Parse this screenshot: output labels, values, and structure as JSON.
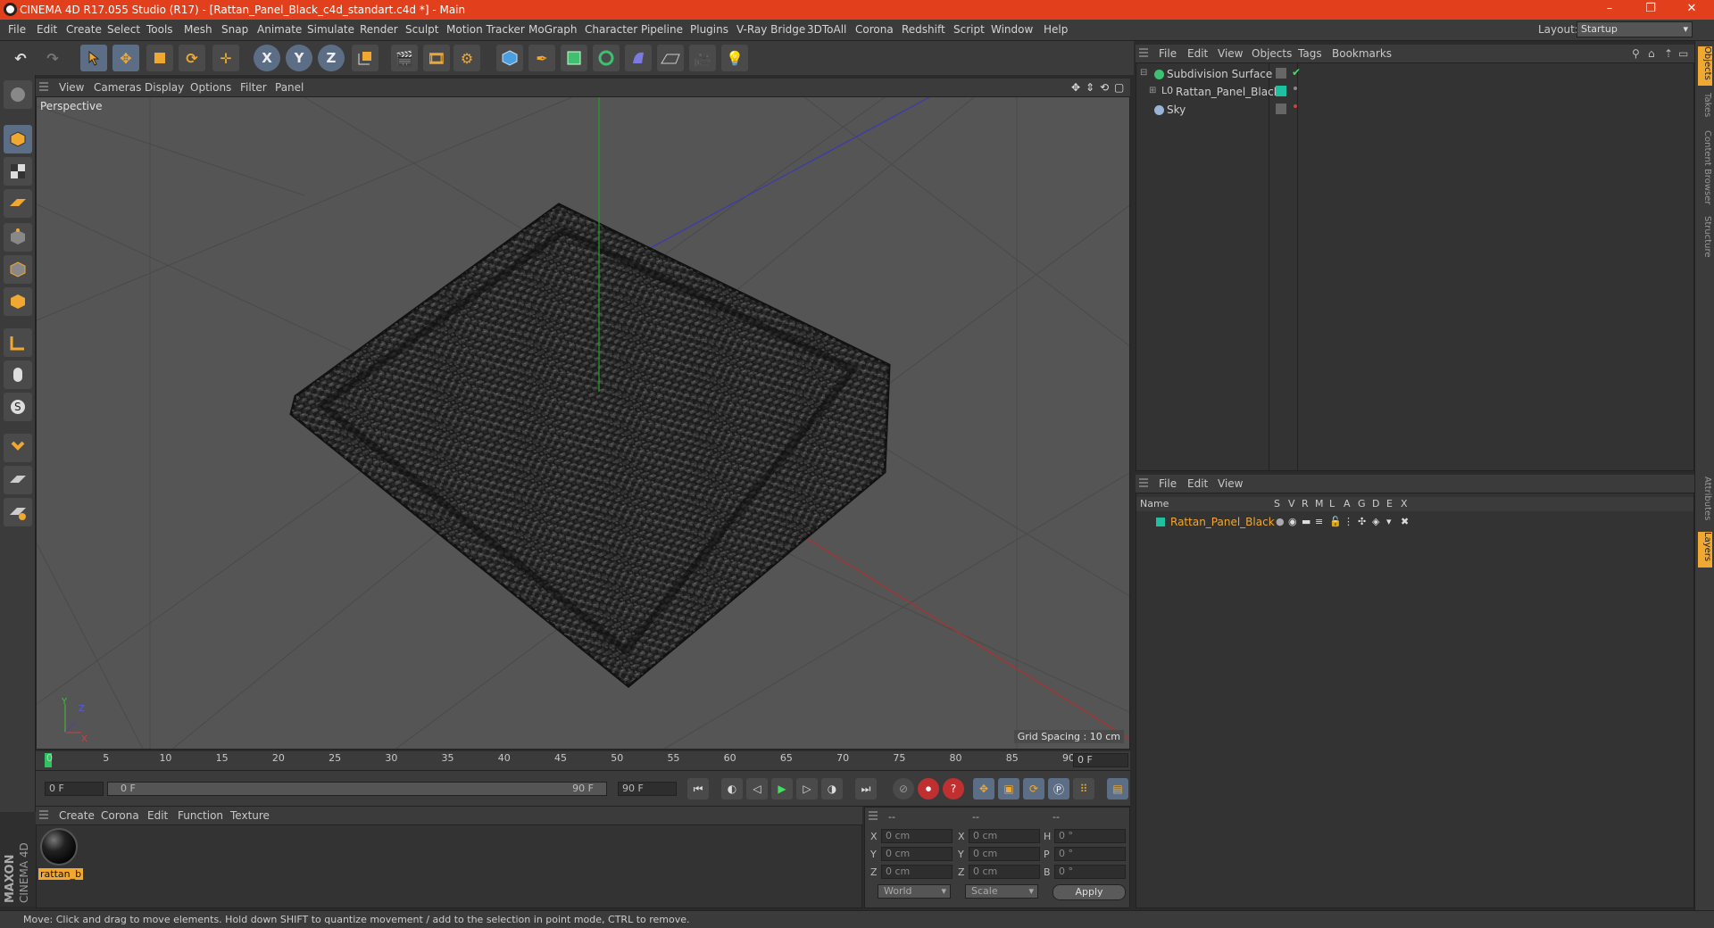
{
  "app": {
    "title": "CINEMA 4D R17.055 Studio (R17) - [Rattan_Panel_Black_c4d_standart.c4d *] - Main",
    "window_controls": [
      "–",
      "❐",
      "✕"
    ],
    "accent_color": "#f0a830",
    "titlebar_color": "#e2401c"
  },
  "menubar": {
    "items": [
      "File",
      "Edit",
      "Create",
      "Select",
      "Tools",
      "Mesh",
      "Snap",
      "Animate",
      "Simulate",
      "Render",
      "Sculpt",
      "Motion Tracker",
      "MoGraph",
      "Character",
      "Pipeline",
      "Plugins",
      "V-Ray Bridge",
      "3DToAll",
      "Corona",
      "Redshift",
      "Script",
      "Window",
      "Help"
    ],
    "layout_label": "Layout:",
    "layout_value": "Startup"
  },
  "toolbar": {
    "icons": [
      "undo-icon",
      "redo-icon",
      "live-selection-icon",
      "move-icon",
      "scale-icon",
      "rotate-icon",
      "multi-tool-icon",
      "x-axis-lock-icon",
      "y-axis-lock-icon",
      "z-axis-lock-icon",
      "coordinate-system-icon",
      "render-view-icon",
      "render-picture-viewer-icon",
      "render-settings-icon",
      "cube-icon",
      "spline-pen-icon",
      "subdivision-icon",
      "array-icon",
      "deformer-icon",
      "floor-icon",
      "camera-icon",
      "light-icon"
    ],
    "axis_labels": [
      "X",
      "Y",
      "Z"
    ]
  },
  "viewport": {
    "menu": [
      "View",
      "Cameras",
      "Display",
      "Options",
      "Filter",
      "Panel"
    ],
    "label": "Perspective",
    "grid_spacing": "Grid Spacing : 10 cm",
    "axis_y_label": "Y",
    "axis_z_label": "Z",
    "axis_x_label": "X"
  },
  "timeline": {
    "ticks": [
      "0",
      "5",
      "10",
      "15",
      "20",
      "25",
      "30",
      "35",
      "40",
      "45",
      "50",
      "55",
      "60",
      "65",
      "70",
      "75",
      "80",
      "85",
      "90"
    ],
    "current_frame": "0 F",
    "start_field": "0 F",
    "range_start": "0 F",
    "range_end": "90 F",
    "end_field": "90 F"
  },
  "materials": {
    "menu": [
      "Create",
      "Corona",
      "Edit",
      "Function",
      "Texture"
    ],
    "items": [
      {
        "name": "rattan_b"
      }
    ]
  },
  "coords": {
    "headers": [
      "--",
      "--",
      "--"
    ],
    "rows": [
      {
        "a": "X",
        "av": "0 cm",
        "b": "X",
        "bv": "0 cm",
        "c": "H",
        "cv": "0 °"
      },
      {
        "a": "Y",
        "av": "0 cm",
        "b": "Y",
        "bv": "0 cm",
        "c": "P",
        "cv": "0 °"
      },
      {
        "a": "Z",
        "av": "0 cm",
        "b": "Z",
        "bv": "0 cm",
        "c": "B",
        "cv": "0 °"
      }
    ],
    "mode1": "World",
    "mode2": "Scale",
    "apply": "Apply"
  },
  "objects": {
    "menu": [
      "File",
      "Edit",
      "View",
      "Objects",
      "Tags",
      "Bookmarks"
    ],
    "tree": [
      {
        "name": "Subdivision Surface",
        "indent": 0
      },
      {
        "name": "Rattan_Panel_Black",
        "indent": 1
      },
      {
        "name": "Sky",
        "indent": 0
      }
    ]
  },
  "layers": {
    "menu": [
      "File",
      "Edit",
      "View"
    ],
    "columns": [
      "Name",
      "S",
      "V",
      "R",
      "M",
      "L",
      "A",
      "G",
      "D",
      "E",
      "X"
    ],
    "rows": [
      {
        "name": "Rattan_Panel_Black",
        "color": "#1fc0a0"
      }
    ]
  },
  "right_tabs": [
    "Objects",
    "Takes",
    "Content Browser",
    "Structure",
    "Attributes",
    "Layers"
  ],
  "status": "Move: Click and drag to move elements. Hold down SHIFT to quantize movement / add to the selection in point mode, CTRL to remove.",
  "maxon": {
    "line1": "MAXON",
    "line2": "CINEMA 4D"
  }
}
